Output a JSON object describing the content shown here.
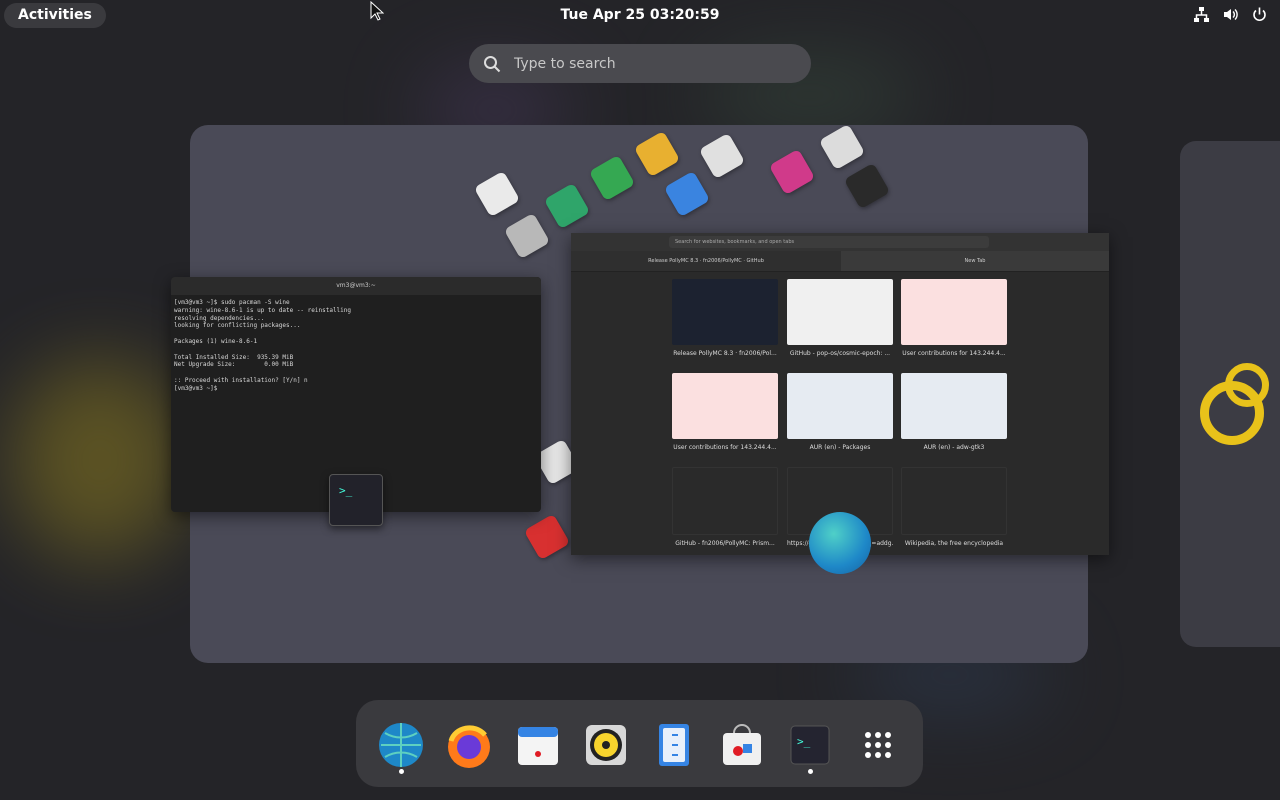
{
  "topbar": {
    "activities_label": "Activities",
    "clock": "Tue Apr 25  03:20:59",
    "tray_icons": [
      "network-icon",
      "volume-icon",
      "power-icon"
    ]
  },
  "search": {
    "placeholder": "Type to search"
  },
  "terminal": {
    "title": "vm3@vm3:~",
    "lines": [
      "[vm3@vm3 ~]$ sudo pacman -S wine",
      "warning: wine-8.6-1 is up to date -- reinstalling",
      "resolving dependencies...",
      "looking for conflicting packages...",
      "",
      "Packages (1) wine-8.6-1",
      "",
      "Total Installed Size:  935.39 MiB",
      "Net Upgrade Size:        0.00 MiB",
      "",
      ":: Proceed with installation? [Y/n] n",
      "[vm3@vm3 ~]$ "
    ]
  },
  "browser": {
    "url_placeholder": "Search for websites, bookmarks, and open tabs",
    "tabs": [
      "Release PollyMC 8.3 · fn2006/PollyMC · GitHub",
      "New Tab"
    ],
    "thumbnails": [
      {
        "caption": "Release PollyMC 8.3 · fn2006/Pol...",
        "style": "dark"
      },
      {
        "caption": "GitHub - pop-os/cosmic-epoch: ...",
        "style": "light"
      },
      {
        "caption": "User contributions for 143.244.4...",
        "style": "pink"
      },
      {
        "caption": "User contributions for 143.244.4...",
        "style": "pink"
      },
      {
        "caption": "AUR (en) - Packages",
        "style": "light"
      },
      {
        "caption": "AUR (en) - adw-gtk3",
        "style": "light"
      },
      {
        "caption": "GitHub - fn2006/PollyMC: Prism...",
        "style": "blank"
      },
      {
        "caption": "https://github.com/search?q=addg...",
        "style": "blank"
      },
      {
        "caption": "Wikipedia, the free encyclopedia",
        "style": "blank"
      }
    ]
  },
  "dock": {
    "items": [
      {
        "name": "web-browser-icon",
        "running": true
      },
      {
        "name": "firefox-icon",
        "running": false
      },
      {
        "name": "calendar-icon",
        "running": false
      },
      {
        "name": "rhythmbox-icon",
        "running": false
      },
      {
        "name": "text-editor-icon",
        "running": false
      },
      {
        "name": "software-store-icon",
        "running": false
      },
      {
        "name": "terminal-icon",
        "running": true
      },
      {
        "name": "show-apps-icon",
        "running": false
      }
    ]
  },
  "colors": {
    "panel": "#3a3a3e",
    "workspace": "#4a4a57",
    "accent": "#3584e4"
  }
}
